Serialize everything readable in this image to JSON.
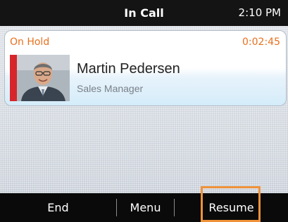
{
  "status_bar": {
    "title": "In Call",
    "time": "2:10 PM"
  },
  "call": {
    "state_label": "On Hold",
    "duration": "0:02:45",
    "contact_name": "Martin Pedersen",
    "contact_title": "Sales Manager",
    "avatar_icon": "contact-photo"
  },
  "softkeys": {
    "end_label": "End",
    "menu_label": "Menu",
    "resume_label": "Resume"
  },
  "colors": {
    "hold_accent": "#e8701e",
    "hold_indicator": "#d6262b",
    "highlight": "#f0923a",
    "bar_background": "#0a0a0a"
  }
}
